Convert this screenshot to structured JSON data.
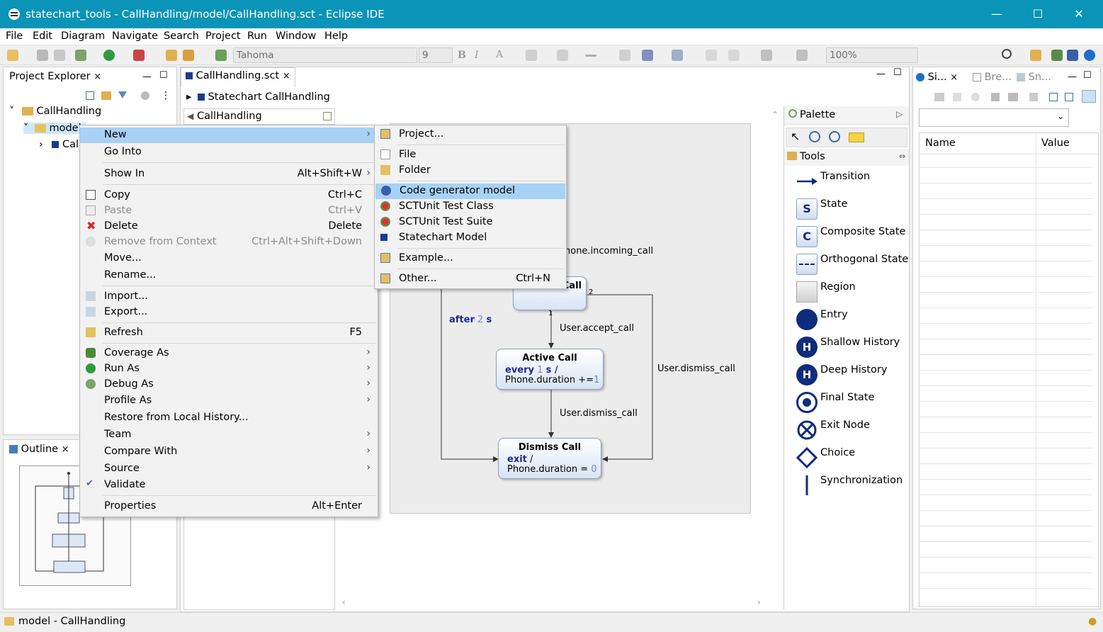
{
  "window": {
    "title": "statechart_tools - CallHandling/model/CallHandling.sct - Eclipse IDE"
  },
  "menubar": [
    "File",
    "Edit",
    "Diagram",
    "Navigate",
    "Search",
    "Project",
    "Run",
    "Window",
    "Help"
  ],
  "toolbar": {
    "font_name": "Tahoma",
    "font_size": "9",
    "zoom": "100%",
    "bold": "B",
    "italic": "I",
    "text_a": "A"
  },
  "project_explorer": {
    "tab": "Project Explorer",
    "tree": {
      "root": "CallHandling",
      "model": "model",
      "child": "Cal"
    }
  },
  "outline": {
    "tab": "Outline"
  },
  "editor": {
    "tab": "CallHandling.sct",
    "breadcrumb": "Statechart CallHandling",
    "combo": "CallHandling"
  },
  "diagram": {
    "states": {
      "incoming": {
        "name": "Incoming Call",
        "visible_name": "Call"
      },
      "active": {
        "name": "Active Call",
        "kw": "every",
        "num": "1",
        "unit": "s /",
        "action_prefix": "Phone.duration +=",
        "action_num": "1"
      },
      "dismiss": {
        "name": "Dismiss Call",
        "kw": "exit",
        "slash": "/",
        "action_prefix": "Phone.duration = ",
        "action_num": "0"
      }
    },
    "transitions": {
      "incoming_trigger": "hone.incoming_call",
      "accept": "User.accept_call",
      "dismiss_right": "User.dismiss_call",
      "dismiss_down": "User.dismiss_call",
      "after_kw": "after",
      "after_num": "2",
      "after_unit": "s",
      "prio1": "1",
      "prio2": "2"
    }
  },
  "palette": {
    "title": "Palette",
    "tools_header": "Tools",
    "items": [
      "Transition",
      "State",
      "Composite State",
      "Orthogonal State",
      "Region",
      "Entry",
      "Shallow History",
      "Deep History",
      "Final State",
      "Exit Node",
      "Choice",
      "Synchronization"
    ],
    "glyphs": {
      "state": "S",
      "composite": "C",
      "history": "H"
    }
  },
  "right_panel": {
    "tabs": [
      "Si...",
      "Bre...",
      "Sn..."
    ],
    "columns": [
      "Name",
      "Value"
    ]
  },
  "context_menu": {
    "items": [
      {
        "label": "New",
        "arrow": "›"
      },
      {
        "label": "Go Into"
      },
      {
        "label": "Show In",
        "accel": "Alt+Shift+W",
        "arrow": "›"
      },
      {
        "label": "Copy",
        "accel": "Ctrl+C"
      },
      {
        "label": "Paste",
        "accel": "Ctrl+V"
      },
      {
        "label": "Delete",
        "accel": "Delete"
      },
      {
        "label": "Remove from Context",
        "accel": "Ctrl+Alt+Shift+Down"
      },
      {
        "label": "Move..."
      },
      {
        "label": "Rename..."
      },
      {
        "label": "Import..."
      },
      {
        "label": "Export..."
      },
      {
        "label": "Refresh",
        "accel": "F5"
      },
      {
        "label": "Coverage As",
        "arrow": "›"
      },
      {
        "label": "Run As",
        "arrow": "›"
      },
      {
        "label": "Debug As",
        "arrow": "›"
      },
      {
        "label": "Profile As",
        "arrow": "›"
      },
      {
        "label": "Restore from Local History..."
      },
      {
        "label": "Team",
        "arrow": "›"
      },
      {
        "label": "Compare With",
        "arrow": "›"
      },
      {
        "label": "Source",
        "arrow": "›"
      },
      {
        "label": "Validate",
        "check": "✔"
      },
      {
        "label": "Properties",
        "accel": "Alt+Enter"
      }
    ]
  },
  "submenu": {
    "items": [
      {
        "label": "Project..."
      },
      {
        "label": "File"
      },
      {
        "label": "Folder"
      },
      {
        "label": "Code generator model"
      },
      {
        "label": "SCTUnit Test Class"
      },
      {
        "label": "SCTUnit Test Suite"
      },
      {
        "label": "Statechart Model"
      },
      {
        "label": "Example..."
      },
      {
        "label": "Other...",
        "accel": "Ctrl+N"
      }
    ]
  },
  "statusbar": {
    "text": "model - CallHandling"
  },
  "colors": {
    "titlebar": "#0a94b7",
    "highlight": "#a8d1f7",
    "node_navy": "#0f2b7c"
  }
}
